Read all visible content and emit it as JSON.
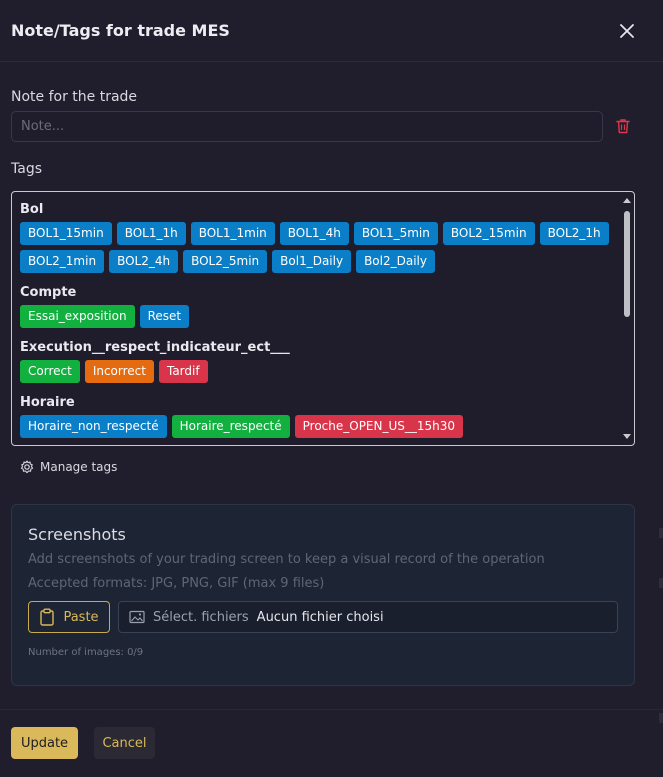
{
  "modal": {
    "title": "Note/Tags for trade MES",
    "close_icon": "close-icon"
  },
  "note": {
    "label": "Note for the trade",
    "placeholder": "Note...",
    "value": "",
    "delete_icon": "trash-icon"
  },
  "tags": {
    "label": "Tags",
    "groups": [
      {
        "title": "Bol",
        "items": [
          {
            "label": "BOL1_15min",
            "color": "#0a7fc7"
          },
          {
            "label": "BOL1_1h",
            "color": "#0a7fc7"
          },
          {
            "label": "BOL1_1min",
            "color": "#0a7fc7"
          },
          {
            "label": "BOL1_4h",
            "color": "#0a7fc7"
          },
          {
            "label": "BOL1_5min",
            "color": "#0a7fc7"
          },
          {
            "label": "BOL2_15min",
            "color": "#0a7fc7"
          },
          {
            "label": "BOL2_1h",
            "color": "#0a7fc7"
          },
          {
            "label": "BOL2_1min",
            "color": "#0a7fc7"
          },
          {
            "label": "BOL2_4h",
            "color": "#0a7fc7"
          },
          {
            "label": "BOL2_5min",
            "color": "#0a7fc7"
          },
          {
            "label": "Bol1_Daily",
            "color": "#0a7fc7"
          },
          {
            "label": "Bol2_Daily",
            "color": "#0a7fc7"
          }
        ]
      },
      {
        "title": "Compte",
        "items": [
          {
            "label": "Essai_exposition",
            "color": "#12b03f"
          },
          {
            "label": "Reset",
            "color": "#0a7fc7"
          }
        ]
      },
      {
        "title": "Execution__respect_indicateur_ect___",
        "items": [
          {
            "label": "Correct",
            "color": "#12b03f"
          },
          {
            "label": "Incorrect",
            "color": "#e56b10"
          },
          {
            "label": "Tardif",
            "color": "#d9354a"
          }
        ]
      },
      {
        "title": "Horaire",
        "items": [
          {
            "label": "Horaire_non_respecté",
            "color": "#0a7fc7"
          },
          {
            "label": "Horaire_respecté",
            "color": "#12b03f"
          },
          {
            "label": "Proche_OPEN_US__15h30",
            "color": "#d9354a"
          }
        ]
      }
    ],
    "manage_label": "Manage tags",
    "manage_icon": "gear-icon"
  },
  "screenshots": {
    "title": "Screenshots",
    "description": "Add screenshots of your trading screen to keep a visual record of the operation",
    "formats": "Accepted formats: JPG, PNG, GIF (max 9 files)",
    "paste_label": "Paste",
    "paste_icon": "clipboard-icon",
    "file_select_label": "Sélect. fichiers",
    "file_none_label": "Aucun fichier choisi",
    "file_icon": "image-icon",
    "count_text": "Number of images: 0/9"
  },
  "footer": {
    "update_label": "Update",
    "cancel_label": "Cancel"
  },
  "colors": {
    "background": "#201e2d",
    "accent": "#d9b95a",
    "danger": "#e0364c",
    "panel": "#1d2434"
  }
}
